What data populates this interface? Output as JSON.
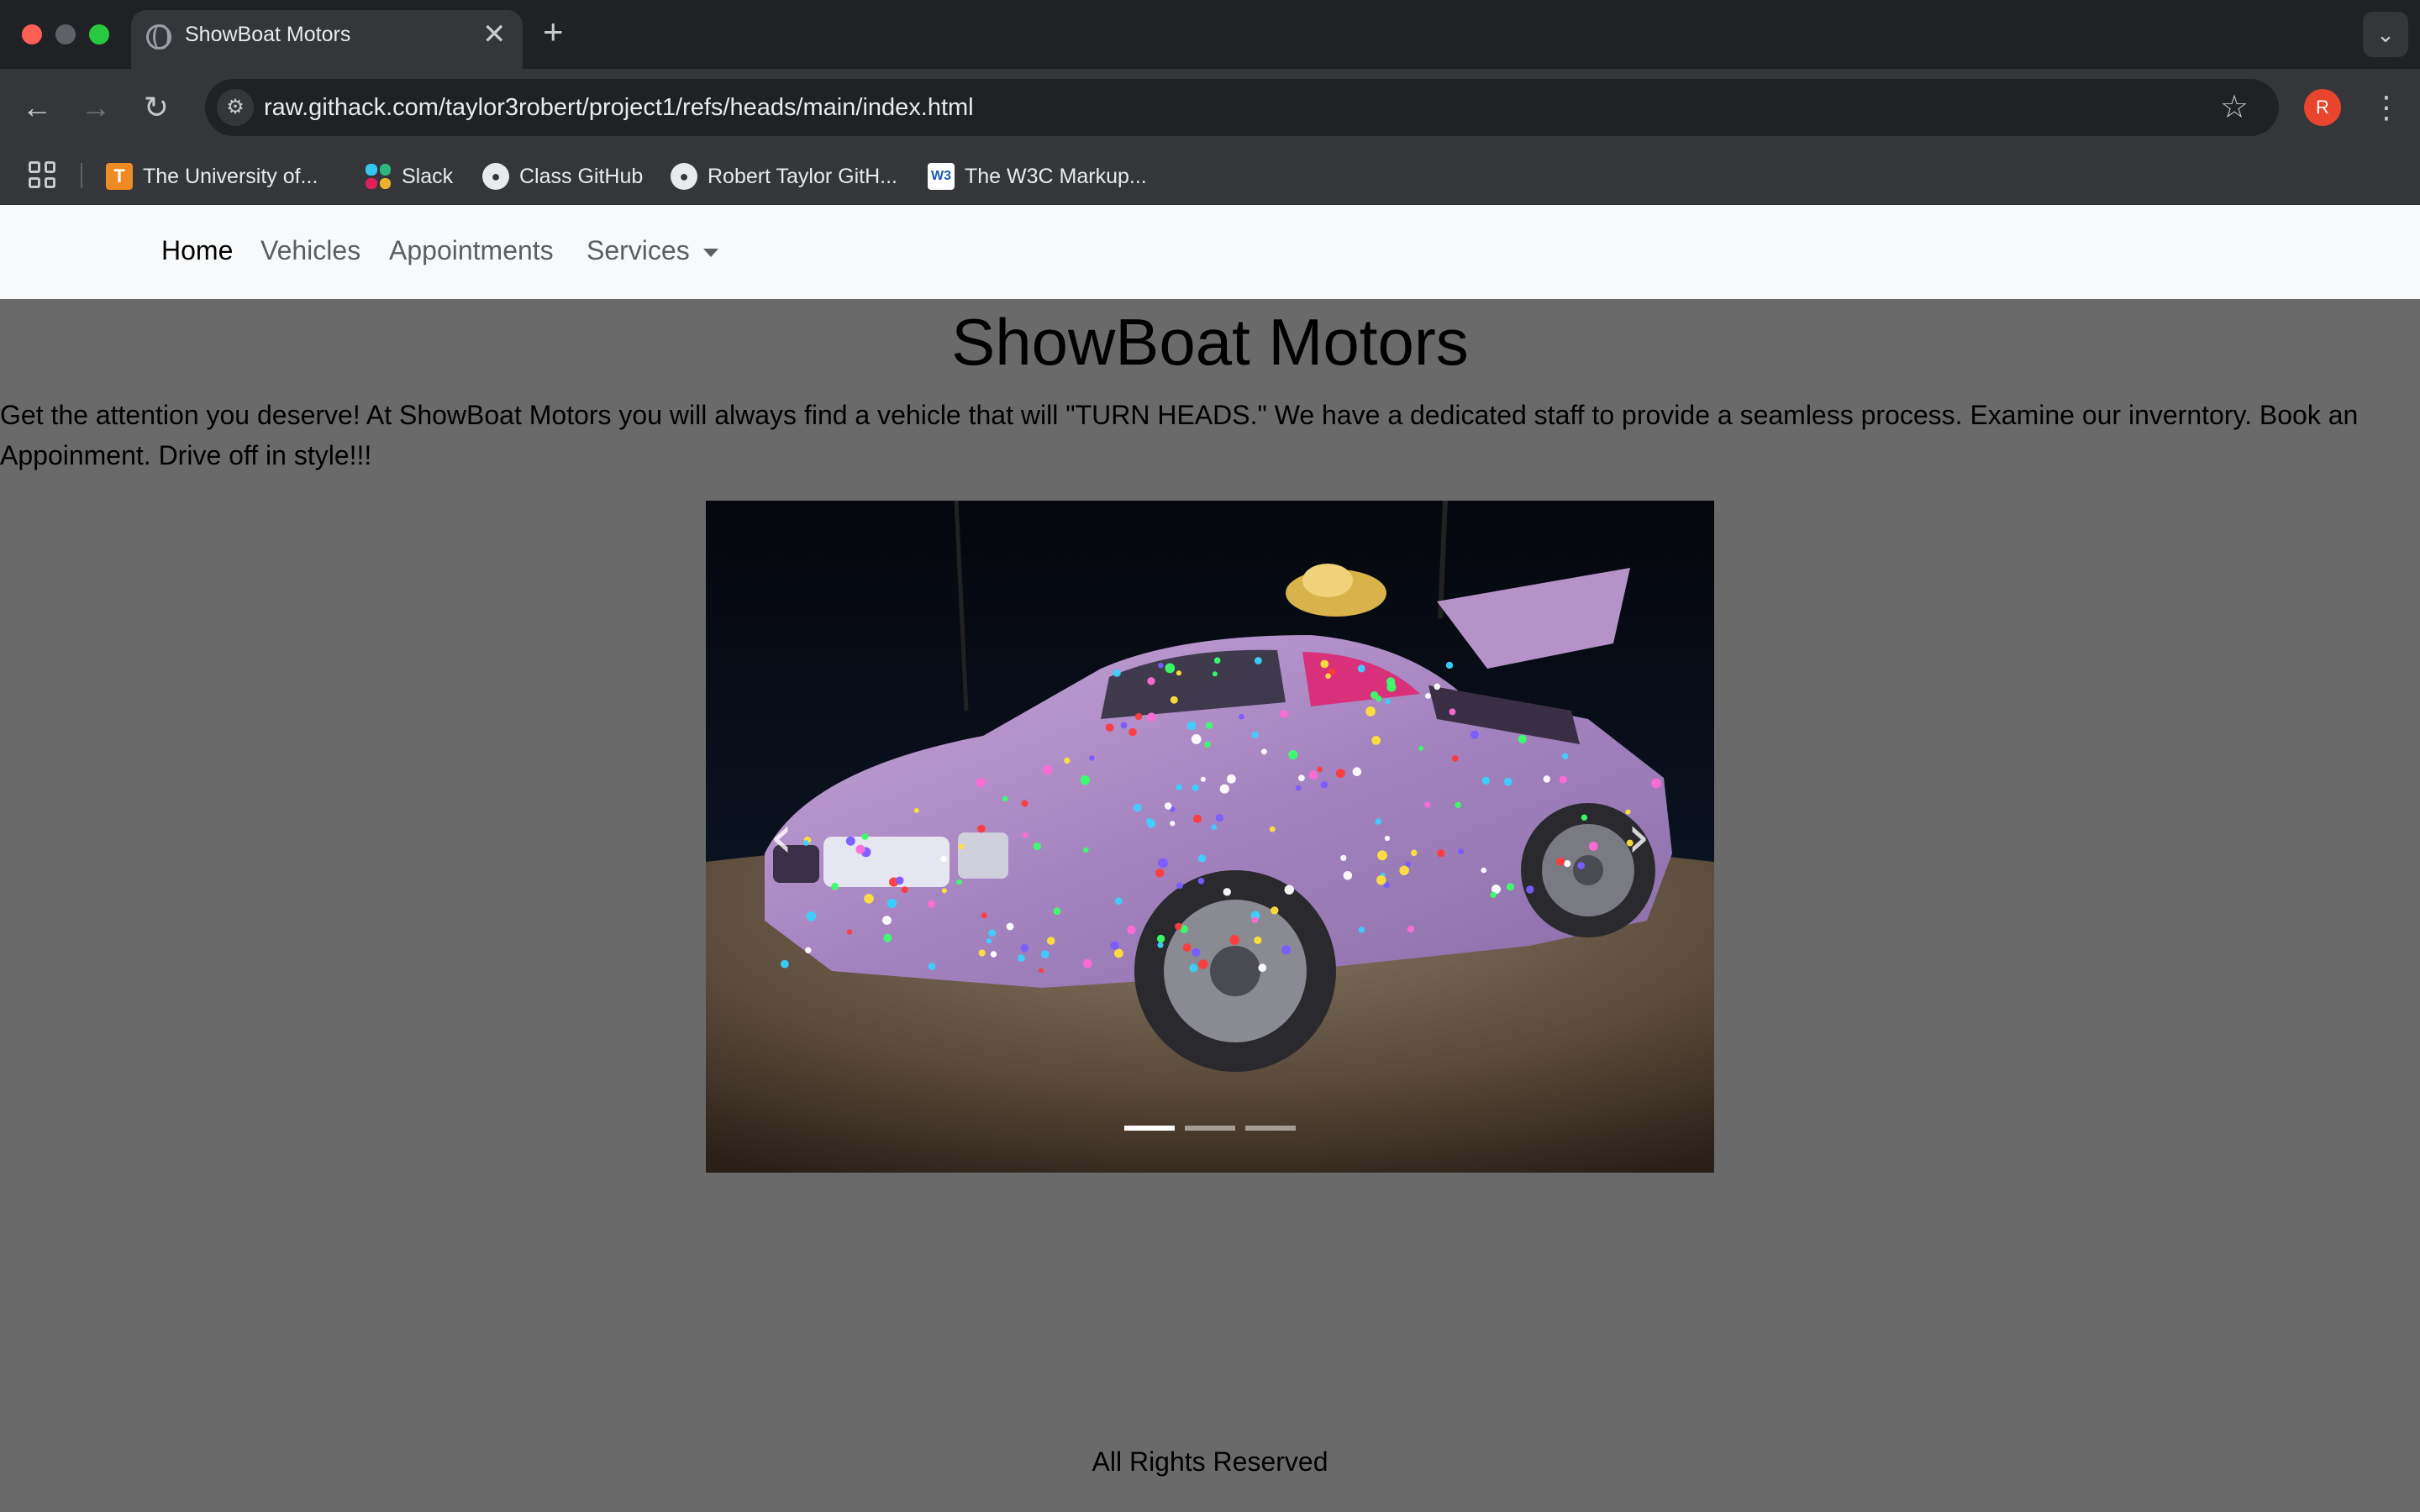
{
  "browser": {
    "tab_title": "ShowBoat Motors",
    "tab_close": "✕",
    "new_tab": "+",
    "url": "raw.githack.com/taylor3robert/project1/refs/heads/main/index.html",
    "profile_initial": "R",
    "bookmarks": [
      {
        "label": "The University of...",
        "icon": "ut-icon"
      },
      {
        "label": "Slack",
        "icon": "slack-icon"
      },
      {
        "label": "Class GitHub",
        "icon": "github-icon"
      },
      {
        "label": "Robert Taylor GitH...",
        "icon": "github-icon"
      },
      {
        "label": "The W3C Markup...",
        "icon": "w3c-icon"
      }
    ]
  },
  "navbar": {
    "links": [
      {
        "label": "Home",
        "active": true
      },
      {
        "label": "Vehicles"
      },
      {
        "label": "Appointments"
      },
      {
        "label": "Services",
        "dropdown": true
      }
    ]
  },
  "page": {
    "title": "ShowBoat Motors",
    "intro": "Get the attention you deserve! At ShowBoat Motors you will always find a vehicle that will \"TURN HEADS.\" We have a dedicated staff to provide a seamless process. Examine our inverntory. Book an Appoinment. Drive off in style!!!",
    "footer": "All Rights Reserved"
  },
  "carousel": {
    "active_index": 0,
    "slide_count": 3,
    "prev_glyph": "‹",
    "next_glyph": "›"
  },
  "colors": {
    "page_background": "#6a6a6a",
    "navbar_background": "#f8f9fa",
    "chrome_dark": "#202124",
    "chrome_toolbar": "#35363a",
    "profile_badge": "#e8452c"
  }
}
